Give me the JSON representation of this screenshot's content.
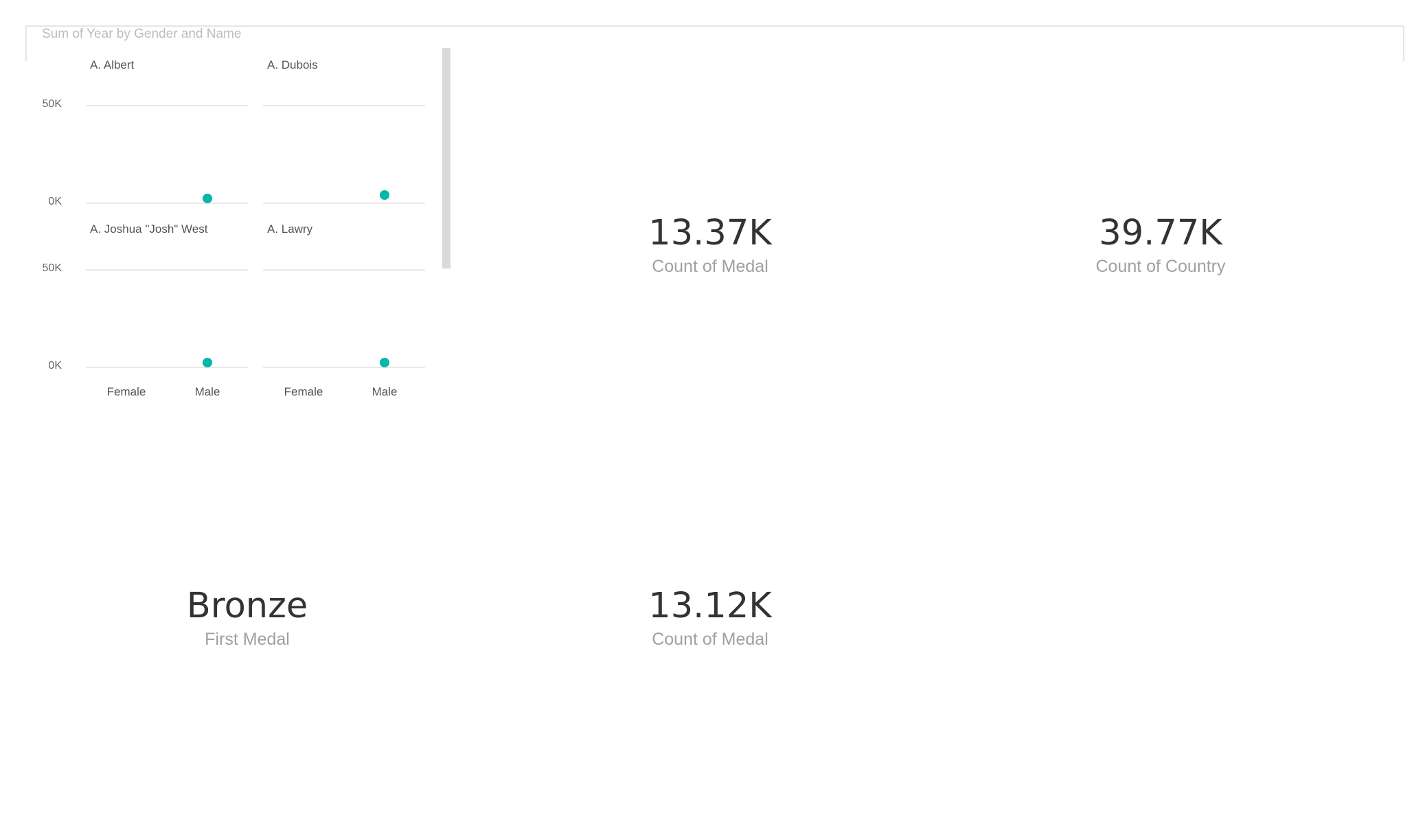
{
  "chart_data": {
    "type": "scatter",
    "title": "Sum of Year by Gender and Name",
    "categories": [
      "Female",
      "Male"
    ],
    "ylim": [
      0,
      50000
    ],
    "y_ticks": [
      "50K",
      "0K"
    ],
    "grid": true,
    "color": "#01B8AA",
    "panels": [
      {
        "name": "A. Albert",
        "values": [
          null,
          1980
        ]
      },
      {
        "name": "A. Dubois",
        "values": [
          null,
          4000
        ]
      },
      {
        "name": "A. Joshua \"Josh\" West",
        "values": [
          null,
          2004
        ]
      },
      {
        "name": "A. Lawry",
        "values": [
          null,
          2008
        ]
      }
    ]
  },
  "cards": [
    {
      "value": "13.37K",
      "label": "Count of Medal"
    },
    {
      "value": "39.77K",
      "label": "Count of Country"
    },
    {
      "value": "Bronze",
      "label": "First Medal"
    },
    {
      "value": "13.12K",
      "label": "Count of Medal"
    }
  ]
}
